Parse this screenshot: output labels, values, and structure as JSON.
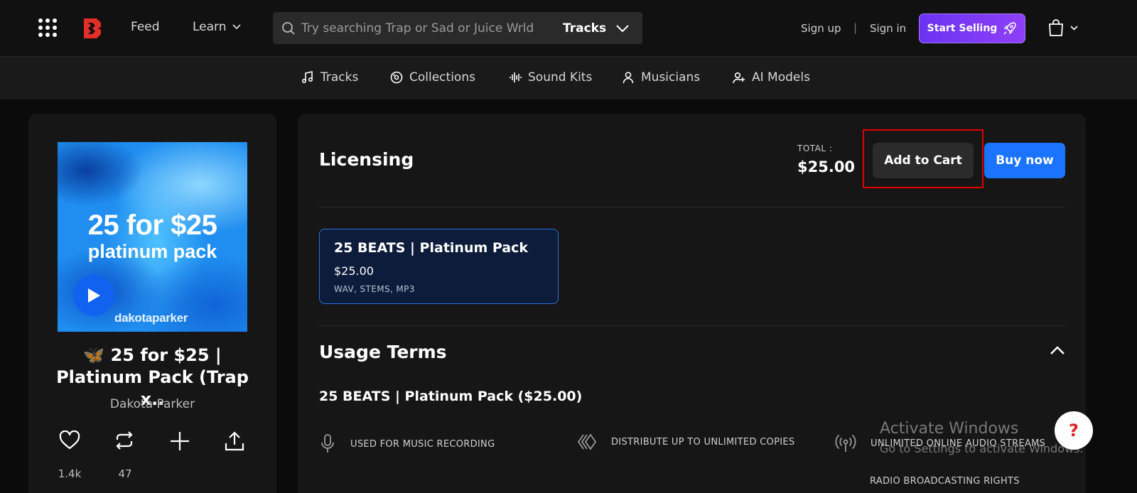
{
  "header": {
    "nav_feed": "Feed",
    "nav_learn": "Learn",
    "search": {
      "placeholder": "Try searching Trap or Sad or Juice Wrld",
      "type": "Tracks"
    },
    "sign_up": "Sign up",
    "separator": "|",
    "sign_in": "Sign in",
    "start_selling": "Start Selling",
    "brand_color": "#e52d27",
    "accent_color": "#7b3af5"
  },
  "categories": [
    {
      "label": "Tracks",
      "icon": "music-note-icon"
    },
    {
      "label": "Collections",
      "icon": "disc-icon"
    },
    {
      "label": "Sound Kits",
      "icon": "waveform-icon"
    },
    {
      "label": "Musicians",
      "icon": "person-icon"
    },
    {
      "label": "AI Models",
      "icon": "person-sparkle-icon"
    }
  ],
  "track": {
    "cover_line1": "25 for $25",
    "cover_line2": "platinum pack",
    "cover_brand": "dakotaparker",
    "title_line1": "🦋 25 for $25 |",
    "title_line2": "Platinum Pack (Trap x..",
    "artist": "Dakota Parker",
    "likes": "1.4k",
    "reposts": "47"
  },
  "licensing": {
    "title": "Licensing",
    "total_label": "TOTAL :",
    "total_value": "$25.00",
    "add_to_cart": "Add to Cart",
    "buy_now": "Buy now",
    "option": {
      "name": "25 BEATS | Platinum Pack",
      "price": "$25.00",
      "formats": "WAV, STEMS, MP3"
    }
  },
  "usage": {
    "title": "Usage Terms",
    "subtitle": "25 BEATS | Platinum Pack ($25.00)",
    "terms": [
      "USED FOR MUSIC RECORDING",
      "DISTRIBUTE UP TO UNLIMITED COPIES",
      "UNLIMITED ONLINE AUDIO STREAMS"
    ],
    "term_radio": "RADIO BROADCASTING RIGHTS"
  },
  "watermark": {
    "line1": "Activate Windows",
    "line2": "Go to Settings to activate Windows."
  },
  "help_label": "?"
}
